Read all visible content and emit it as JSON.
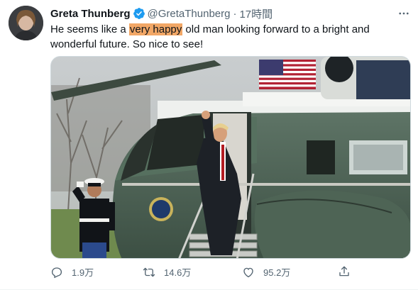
{
  "author": {
    "display_name": "Greta Thunberg",
    "handle": "@GretaThunberg",
    "separator": "·",
    "timestamp": "17時間",
    "verified": true
  },
  "tweet": {
    "text_before": "He seems like a ",
    "text_highlight": "very happy",
    "text_after": " old man looking forward to a bright and wonderful future. So nice to see!"
  },
  "actions": {
    "reply_count": "1.9万",
    "retweet_count": "14.6万",
    "like_count": "95.2万"
  },
  "colors": {
    "highlight": "#f2a766",
    "verified": "#1d9bf0",
    "muted": "#536471"
  },
  "icons": [
    "more-icon",
    "verified-badge-icon",
    "reply-icon",
    "retweet-icon",
    "like-icon",
    "share-icon"
  ]
}
